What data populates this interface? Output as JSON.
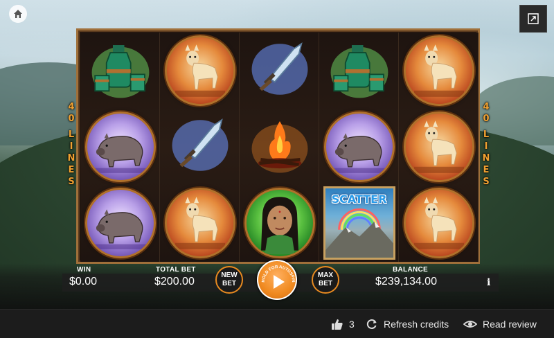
{
  "game": {
    "lines_label_left": [
      "4",
      "0",
      "L",
      "I",
      "N",
      "E",
      "S"
    ],
    "lines_label_right": [
      "4",
      "0",
      "L",
      "I",
      "N",
      "E",
      "S"
    ],
    "reels": [
      [
        "potion",
        "boar",
        "boar"
      ],
      [
        "deer",
        "dagger",
        "deer"
      ],
      [
        "dagger",
        "campfire",
        "girl"
      ],
      [
        "potion",
        "boar",
        "scatter"
      ],
      [
        "deer",
        "deer",
        "deer"
      ]
    ],
    "scatter_label": "SCATTER"
  },
  "panel": {
    "win_label": "WIN",
    "win_value": "$0.00",
    "total_bet_label": "TOTAL BET",
    "total_bet_value": "$200.00",
    "new_bet_label": "NEW BET",
    "spin_hint": "HOLD FOR AUTOSPIN",
    "max_bet_label": "MAX BET",
    "balance_label": "BALANCE",
    "balance_value": "$239,134.00",
    "info_label": "i"
  },
  "footer": {
    "likes_count": "3",
    "refresh_label": "Refresh credits",
    "review_label": "Read review"
  },
  "colors": {
    "accent": "#e88a20",
    "frame": "#a0703a",
    "lines_text": "#f0a030"
  }
}
